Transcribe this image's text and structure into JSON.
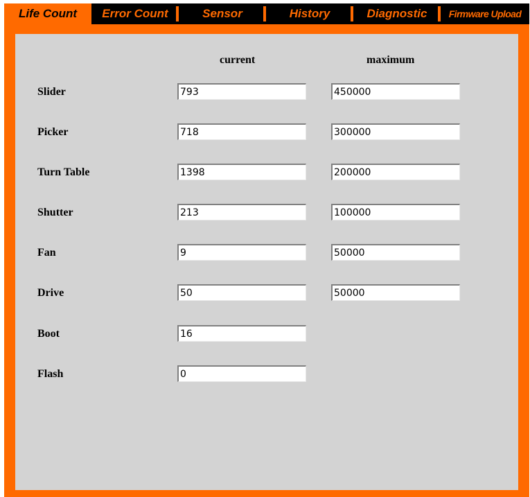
{
  "tabs": [
    {
      "label": "Life Count",
      "active": true
    },
    {
      "label": "Error Count",
      "active": false
    },
    {
      "label": "Sensor",
      "active": false
    },
    {
      "label": "History",
      "active": false
    },
    {
      "label": "Diagnostic",
      "active": false
    },
    {
      "label": "Firmware Upload",
      "active": false
    }
  ],
  "columns": {
    "current": "current",
    "maximum": "maximum"
  },
  "rows": [
    {
      "label": "Slider",
      "current": "793",
      "maximum": "450000"
    },
    {
      "label": "Picker",
      "current": "718",
      "maximum": "300000"
    },
    {
      "label": "Turn Table",
      "current": "1398",
      "maximum": "200000"
    },
    {
      "label": "Shutter",
      "current": "213",
      "maximum": "100000"
    },
    {
      "label": "Fan",
      "current": "9",
      "maximum": "50000"
    },
    {
      "label": "Drive",
      "current": "50",
      "maximum": "50000"
    },
    {
      "label": "Boot",
      "current": "16"
    },
    {
      "label": "Flash",
      "current": "0"
    }
  ],
  "colors": {
    "accent": "#ff6a00",
    "tab_background": "#000000",
    "panel_background": "#d3d3d3"
  }
}
